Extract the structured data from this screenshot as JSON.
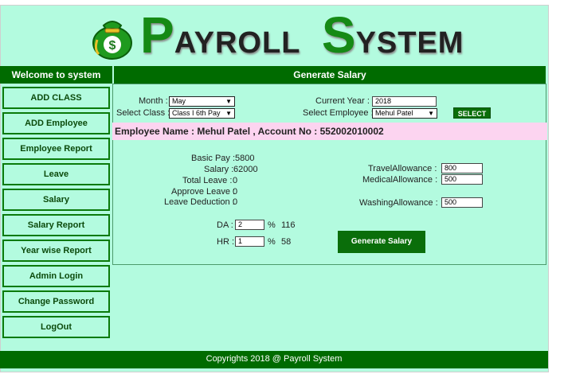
{
  "header": {
    "logo_icon": "money-bag-icon",
    "title_initial_1": "P",
    "title_rest_1": "AYROLL",
    "title_initial_2": "S",
    "title_rest_2": "YSTEM",
    "title_color": "#158a15"
  },
  "sidebar": {
    "heading": "Welcome to system",
    "items": [
      {
        "label": "ADD CLASS"
      },
      {
        "label": "ADD Employee"
      },
      {
        "label": "Employee Report"
      },
      {
        "label": "Leave"
      },
      {
        "label": "Salary"
      },
      {
        "label": "Salary Report"
      },
      {
        "label": "Year wise Report"
      },
      {
        "label": "Admin Login"
      },
      {
        "label": "Change Password"
      },
      {
        "label": "LogOut"
      }
    ]
  },
  "main": {
    "heading": "Generate Salary",
    "month_label": "Month :",
    "month_value": "May",
    "class_label": "Select Class :",
    "class_value": "Class I 6th Pay",
    "year_label": "Current Year :",
    "year_value": "2018",
    "employee_label": "Select Employee :",
    "employee_value": "Mehul Patel",
    "select_button": "SELECT",
    "employee_info": "Employee Name : Mehul Patel  , Account No : 552002010002",
    "basic_pay_label": "Basic Pay :",
    "basic_pay_value": "5800",
    "salary_label": "Salary :",
    "salary_value": "62000",
    "total_leave_label": "Total Leave :",
    "total_leave_value": "0",
    "approve_leave_label": "Approve Leave :",
    "approve_leave_value": "0",
    "leave_deduction_label": "Leave Deduction :",
    "leave_deduction_value": "0",
    "travel_label": "TravelAllowance :",
    "travel_value": "800",
    "medical_label": "MedicalAllowance :",
    "medical_value": "500",
    "washing_label": "WashingAllowance :",
    "washing_value": "500",
    "da_label": "DA :",
    "da_value": "2",
    "da_percent": "%",
    "da_amount": "116",
    "hr_label": "HR :",
    "hr_value": "1",
    "hr_percent": "%",
    "hr_amount": "58",
    "generate_button": "Generate Salary"
  },
  "footer": {
    "text": "Copyrights 2018 @ Payroll System"
  },
  "colors": {
    "background": "#b3fbdf",
    "dark_green": "#006b00",
    "pink_bar": "#fcd4f0"
  }
}
